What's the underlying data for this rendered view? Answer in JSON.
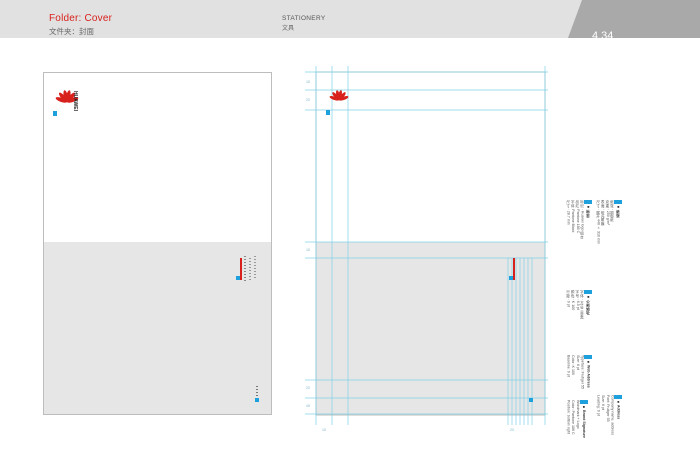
{
  "header": {
    "title_en": "Folder: Cover",
    "title_zh": "文件夹：封面",
    "section_en": "STATIONERY",
    "section_zh": "文具",
    "page_number": "4.34"
  },
  "colors": {
    "brand_red": "#d8211c",
    "accent_blue": "#1ea0dc",
    "guide_cyan": "#7fd0e6",
    "header_grey": "#e1e1e1",
    "tab_grey": "#a9a9a9",
    "panel_grey": "#e6e6e6"
  },
  "logo": {
    "wordmark": "HUAWEI",
    "icon": "huawei-flower-icon"
  },
  "specs": [
    {
      "heading": "■ 标志",
      "lines": [
        "标识：Huawei logo 组合",
        "品红: Pantone 186 C",
        "字体: Pantone Black",
        "尺寸：28.7 mm"
      ]
    },
    {
      "heading": "■ 公司地址",
      "lines": [
        "字体：方正兰亭黑",
        "字号：6.5 pt",
        "颜色：K 100",
        "行距：9 pt"
      ]
    },
    {
      "heading": "■ 纸张",
      "lines": [
        "纸张：铜版纸",
        "克重：250 g/m²",
        "表面：哑光覆膜",
        "尺寸：展开 440 × 310 mm"
      ]
    },
    {
      "heading": "■ Web Address",
      "lines": [
        "Typeface: Frutiger 55",
        "Size: 6 pt",
        "Color: K 100",
        "Baseline: 9 pt"
      ]
    },
    {
      "heading": "■ Brand Signature",
      "lines": [
        "Wordmark + Logo",
        "Color: Pantone 186 C",
        "Position: bottom right",
        "Width: 16 mm"
      ]
    },
    {
      "heading": "■ Address",
      "lines": [
        "Company name, address",
        "Font: Frutiger 55",
        "Size: 6 pt",
        "Leading: 9 pt"
      ]
    }
  ],
  "dimensions": {
    "top": [
      "15",
      "20"
    ],
    "side": [
      "15",
      "20",
      "45",
      "15",
      "20"
    ]
  }
}
